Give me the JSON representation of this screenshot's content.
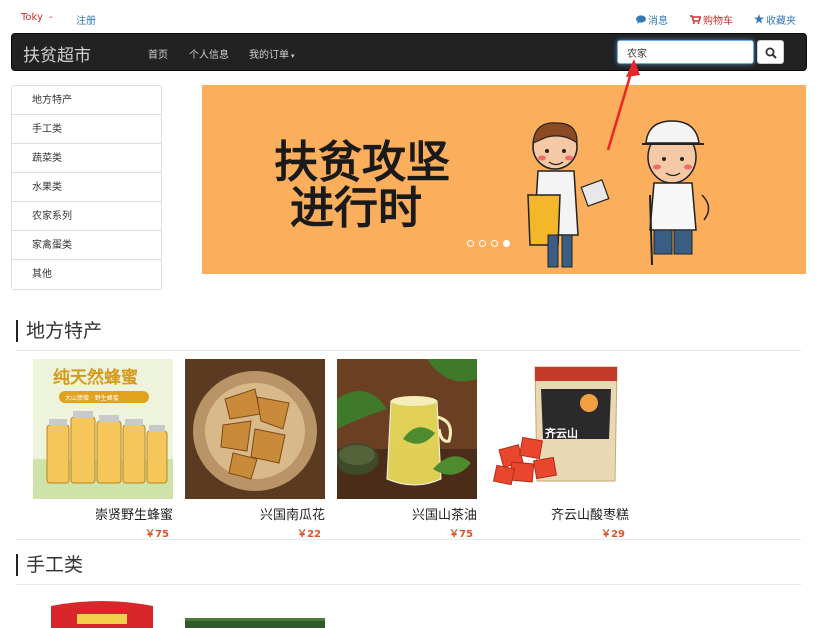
{
  "topbar": {
    "user_name": "Toky",
    "user_caret": "-",
    "register": "注册",
    "messages": "消息",
    "cart": "购物车",
    "favorites": "收藏夹"
  },
  "navbar": {
    "brand": "扶贫超市",
    "home": "首页",
    "profile": "个人信息",
    "orders": "我的订单",
    "search_value": "农家"
  },
  "sidebar": {
    "items": [
      "地方特产",
      "手工类",
      "蔬菜类",
      "水果类",
      "农家系列",
      "家禽蛋类",
      "其他"
    ]
  },
  "banner": {
    "headline_line1": "扶贫攻坚",
    "headline_line2": "进行时",
    "slide_count": 4,
    "active_slide": 3
  },
  "sections": [
    {
      "title": "地方特产",
      "products": [
        {
          "name": "崇贤野生蜂蜜",
          "price": "￥75",
          "image_label_1": "纯天然蜂蜜",
          "image_label_2": "大山馈赠 · 野生蜂蜜"
        },
        {
          "name": "兴国南瓜花",
          "price": "￥22"
        },
        {
          "name": "兴国山茶油",
          "price": "￥75"
        },
        {
          "name": "齐云山酸枣糕",
          "price": "￥29",
          "image_label_1": "齐云山"
        }
      ]
    },
    {
      "title": "手工类",
      "products": []
    }
  ],
  "colors": {
    "navbar_bg": "#222222",
    "banner_bg": "#fbae5c",
    "price": "#e0522b",
    "link_blue": "#337ab7",
    "link_red": "#c9302c",
    "annotation_arrow": "#e8262a"
  },
  "icons": {
    "messages": "comment-icon",
    "cart": "shopping-cart-icon",
    "favorites": "star-icon",
    "search": "search-icon"
  }
}
